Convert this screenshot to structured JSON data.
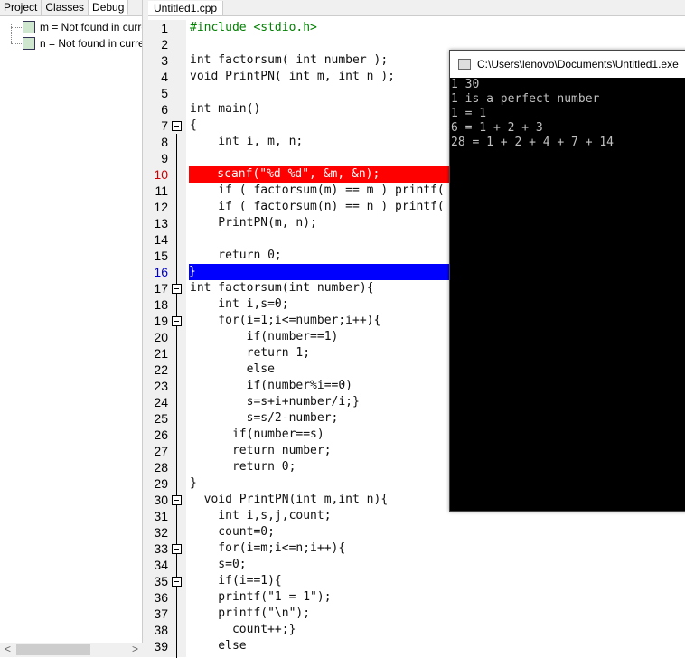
{
  "left_panel": {
    "tabs": [
      "Project",
      "Classes",
      "Debug"
    ],
    "watches": [
      "m = Not found in current context",
      "n = Not found in current context"
    ],
    "scroll_left": "<",
    "scroll_right": ">"
  },
  "editor": {
    "tab": "Untitled1.cpp",
    "breakpoint_line": 10,
    "current_line": 16,
    "lines": [
      "#include <stdio.h>",
      "",
      "int factorsum( int number );",
      "void PrintPN( int m, int n );",
      "",
      "int main()",
      "{",
      "    int i, m, n;",
      "",
      "    scanf(\"%d %d\", &m, &n);",
      "    if ( factorsum(m) == m ) printf(",
      "    if ( factorsum(n) == n ) printf(",
      "    PrintPN(m, n);",
      "",
      "    return 0;",
      "}",
      "int factorsum(int number){",
      "    int i,s=0;",
      "    for(i=1;i<=number;i++){",
      "        if(number==1)",
      "        return 1;",
      "        else",
      "        if(number%i==0)",
      "        s=s+i+number/i;}",
      "        s=s/2-number;",
      "      if(number==s)",
      "      return number;",
      "      return 0;",
      "}",
      "  void PrintPN(int m,int n){",
      "    int i,s,j,count;",
      "    count=0;",
      "    for(i=m;i<=n;i++){",
      "    s=0;",
      "    if(i==1){",
      "    printf(\"1 = 1\");",
      "    printf(\"\\n\");",
      "      count++;}",
      "    else"
    ],
    "fold_lines": [
      7,
      17,
      19,
      30,
      33,
      35
    ]
  },
  "console": {
    "title": "C:\\Users\\lenovo\\Documents\\Untitled1.exe",
    "output": [
      "1 30",
      "1 is a perfect number",
      "1 = 1",
      "6 = 1 + 2 + 3",
      "28 = 1 + 2 + 4 + 7 + 14"
    ]
  }
}
